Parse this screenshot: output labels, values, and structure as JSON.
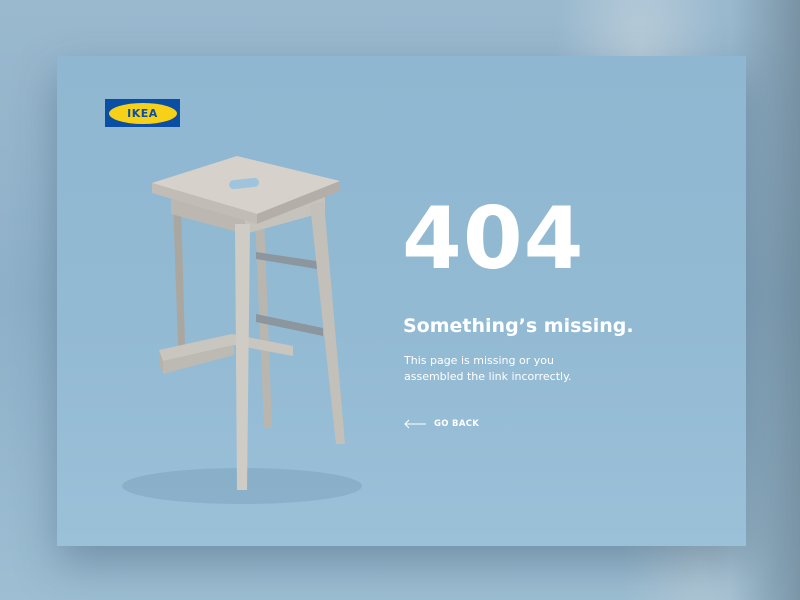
{
  "brand": {
    "logo_text": "IKEA",
    "colors": {
      "blue": "#0a4fa3",
      "yellow": "#f7d117"
    }
  },
  "error": {
    "code": "404",
    "title": "Something’s missing.",
    "description_lines": [
      "This page is missing or you",
      "assembled the link incorrectly."
    ]
  },
  "actions": {
    "go_back_label": "GO BACK",
    "go_back_icon": "arrow-left-icon"
  },
  "illustration": {
    "subject": "stool-icon"
  },
  "colors": {
    "background": "#93bad3",
    "text": "#ffffff"
  }
}
